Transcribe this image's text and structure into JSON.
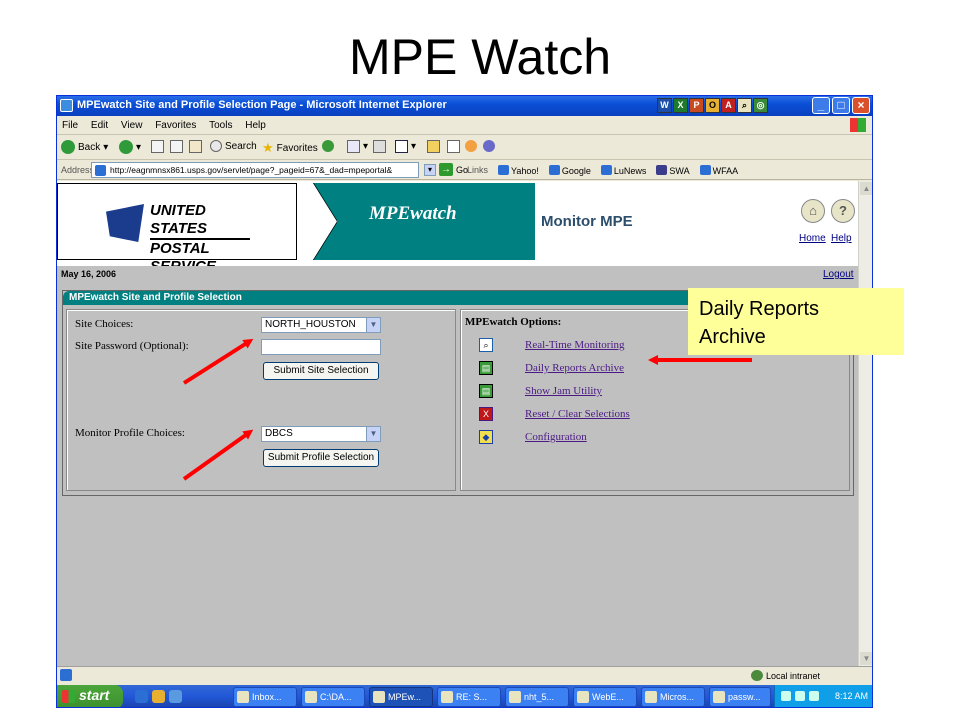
{
  "slide": {
    "title": "MPE Watch"
  },
  "browser": {
    "window_title": "MPEwatch Site and Profile Selection Page - Microsoft Internet Explorer",
    "menu": [
      "File",
      "Edit",
      "View",
      "Favorites",
      "Tools",
      "Help"
    ],
    "toolbar": {
      "back": "Back",
      "search": "Search",
      "favorites": "Favorites"
    },
    "address_label": "Address",
    "address_url": "http://eagnmnsx861.usps.gov/servlet/page?_pageid=67&_dad=mpeportal&",
    "go_label": "Go",
    "links_label": "Links",
    "links": [
      "Yahoo!",
      "Google",
      "LuNews",
      "SWA",
      "WFAA"
    ],
    "status_zone": "Local intranet"
  },
  "page": {
    "usps_line1": "UNITED STATES",
    "usps_line2": "POSTAL SERVICE",
    "app_logo": "MPEwatch",
    "monitor_label": "Monitor MPE",
    "home_link": "Home",
    "help_link": "Help",
    "help_icon": "?",
    "date": "May 16, 2006",
    "logout": "Logout",
    "panel_title": "MPEwatch Site and Profile Selection",
    "site_choices_label": "Site Choices:",
    "site_choices_value": "NORTH_HOUSTON",
    "site_password_label": "Site Password (Optional):",
    "submit_site": "Submit Site Selection",
    "monitor_profile_label": "Monitor Profile Choices:",
    "monitor_profile_value": "DBCS",
    "submit_profile": "Submit Profile Selection",
    "options_title": "MPEwatch Options:",
    "options": [
      {
        "label": "Real-Time Monitoring",
        "icon": "magnifier-icon"
      },
      {
        "label": "Daily Reports Archive",
        "icon": "report-icon"
      },
      {
        "label": "Show Jam Utility",
        "icon": "jam-icon"
      },
      {
        "label": "Reset / Clear Selections",
        "icon": "reset-x-icon"
      },
      {
        "label": "Configuration",
        "icon": "configuration-icon"
      }
    ]
  },
  "taskbar": {
    "start": "start",
    "tasks": [
      "Inbox...",
      "C:\\DA...",
      "MPEw...",
      "RE: S...",
      "nht_5...",
      "WebE...",
      "Micros...",
      "passw..."
    ],
    "clock": "8:12 AM"
  },
  "callout": {
    "line1": "Daily Reports",
    "line2": "Archive"
  },
  "colors": {
    "teal": "#008080",
    "callout_bg": "#ffff99",
    "arrow": "#ff0000"
  }
}
